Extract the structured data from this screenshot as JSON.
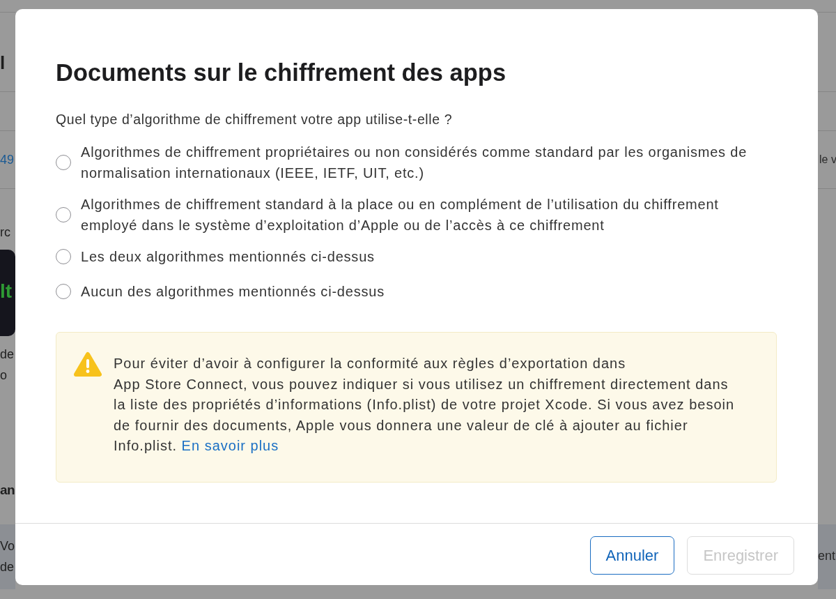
{
  "background_page": {
    "left_edge": {
      "title": "l",
      "link": "49",
      "label": "rc",
      "app_icon_text": "lt",
      "caption_lines": [
        "de",
        "o"
      ],
      "section_heading": "an",
      "footer_lines": [
        "Vo",
        "de"
      ]
    },
    "right_edge": {
      "row_text": "le v",
      "footer_text": "ent"
    }
  },
  "dialog": {
    "title": "Documents sur le chiffrement des apps",
    "question": "Quel type d’algorithme de chiffrement votre app utilise-t-elle ?",
    "options": [
      {
        "label": "Algorithmes de chiffrement propriétaires ou non considérés comme standard par les organismes de normalisation internationaux (IEEE, IETF, UIT, etc.)",
        "selected": false
      },
      {
        "label": "Algorithmes de chiffrement standard à la place ou en complément de l’utilisation du chiffrement employé dans le système d’exploitation d’Apple ou de l’accès à ce chiffrement",
        "selected": false
      },
      {
        "label": "Les deux algorithmes mentionnés ci-dessus",
        "selected": false
      },
      {
        "label": "Aucun des algorithmes mentionnés ci-dessus",
        "selected": false
      }
    ],
    "notice": {
      "text": "Pour éviter d’avoir à configurer la conformité aux règles d’exportation dans\nApp Store Connect, vous pouvez indiquer si vous utilisez un chiffrement directement dans la liste des propriétés d’informations (Info.plist) de votre projet Xcode. Si vous avez besoin de fournir des documents, Apple vous donnera une valeur de clé à ajouter au fichier Info.plist.",
      "link": "En savoir plus"
    },
    "buttons": [
      {
        "label": "Annuler",
        "disabled": false
      },
      {
        "label": "Enregistrer",
        "disabled": true
      }
    ]
  }
}
